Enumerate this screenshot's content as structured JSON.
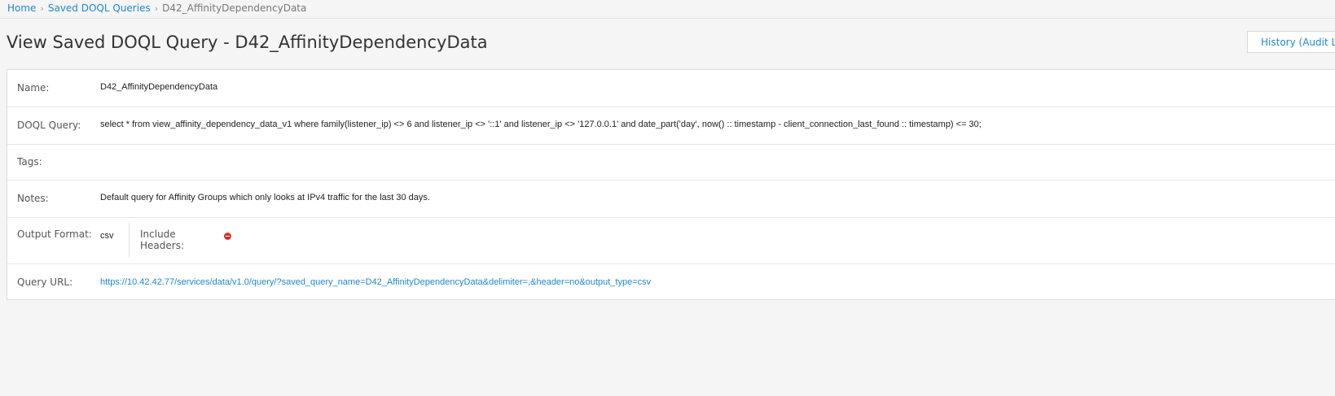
{
  "breadcrumb": {
    "items": [
      "Home",
      "Saved DOQL Queries"
    ],
    "separator": "›",
    "current": "D42_AffinityDependencyData"
  },
  "header": {
    "title": "View Saved DOQL Query - D42_AffinityDependencyData",
    "history_button": "History (Audit Log)"
  },
  "details": {
    "name": {
      "label": "Name:",
      "value": "D42_AffinityDependencyData"
    },
    "query": {
      "label": "DOQL Query:",
      "value": "select * from view_affinity_dependency_data_v1 where family(listener_ip) <> 6 and listener_ip <> '::1' and listener_ip <> '127.0.0.1' and date_part('day', now() :: timestamp - client_connection_last_found :: timestamp) <= 30;"
    },
    "tags": {
      "label": "Tags:",
      "value": ""
    },
    "notes": {
      "label": "Notes:",
      "value": "Default query for Affinity Groups which only looks at IPv4 traffic for the last 30 days."
    },
    "output_format": {
      "label": "Output Format:",
      "value": "csv",
      "include_headers_label": "Include Headers:",
      "include_headers_icon": "minus-circle-icon",
      "include_headers_color": "#d9302a"
    },
    "query_url": {
      "label": "Query URL:",
      "value": "https://10.42.42.77/services/data/v1.0/query/?saved_query_name=D42_AffinityDependencyData&delimiter=,&header=no&output_type=csv"
    }
  },
  "colors": {
    "link": "#1e88d0",
    "background": "#f5f5f5",
    "panel": "#ffffff"
  }
}
